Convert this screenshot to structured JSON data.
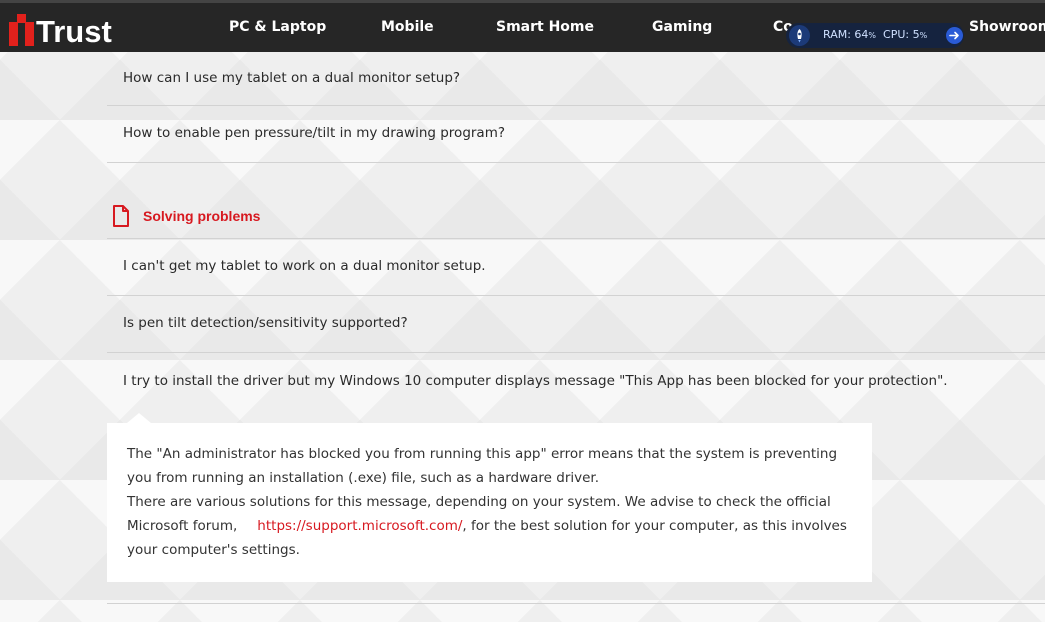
{
  "nav": {
    "brand": "Trust",
    "items": [
      {
        "label": "PC & Laptop"
      },
      {
        "label": "Mobile"
      },
      {
        "label": "Smart Home"
      },
      {
        "label": "Gaming"
      },
      {
        "label": "Co"
      },
      {
        "label": "Showroom"
      }
    ],
    "brand_color": "#e2211c"
  },
  "system_monitor": {
    "ram_label": "RAM:",
    "ram_value": "64",
    "cpu_label": "CPU:",
    "cpu_value": "5",
    "unit": "%",
    "icons": [
      "rocket-icon",
      "arrow-right-icon"
    ]
  },
  "faq_top": [
    {
      "question": "How can I use my tablet on a dual monitor setup?"
    },
    {
      "question": "How to enable pen pressure/tilt in my drawing program?"
    }
  ],
  "section": {
    "title": "Solving problems",
    "icon": "document-icon",
    "accent": "#d71920"
  },
  "faq_problems": [
    {
      "question": "I can't get my tablet to work on a dual monitor setup."
    },
    {
      "question": "Is pen tilt detection/sensitivity supported?"
    },
    {
      "question": "I try to install the driver but my Windows 10 computer displays message \"This App has been blocked for your protection\"."
    }
  ],
  "answer": {
    "line1": "The \"An administrator has blocked you from running this app\" error means that the system is preventing you from running an installation (.exe) file, such as a hardware driver.",
    "line2": "There are various solutions for this message, depending on your system. We advise to check the official Microsoft forum,",
    "link": "https://support.microsoft.com/",
    "line3": ", for the best solution for your computer, as this involves your computer's settings."
  }
}
